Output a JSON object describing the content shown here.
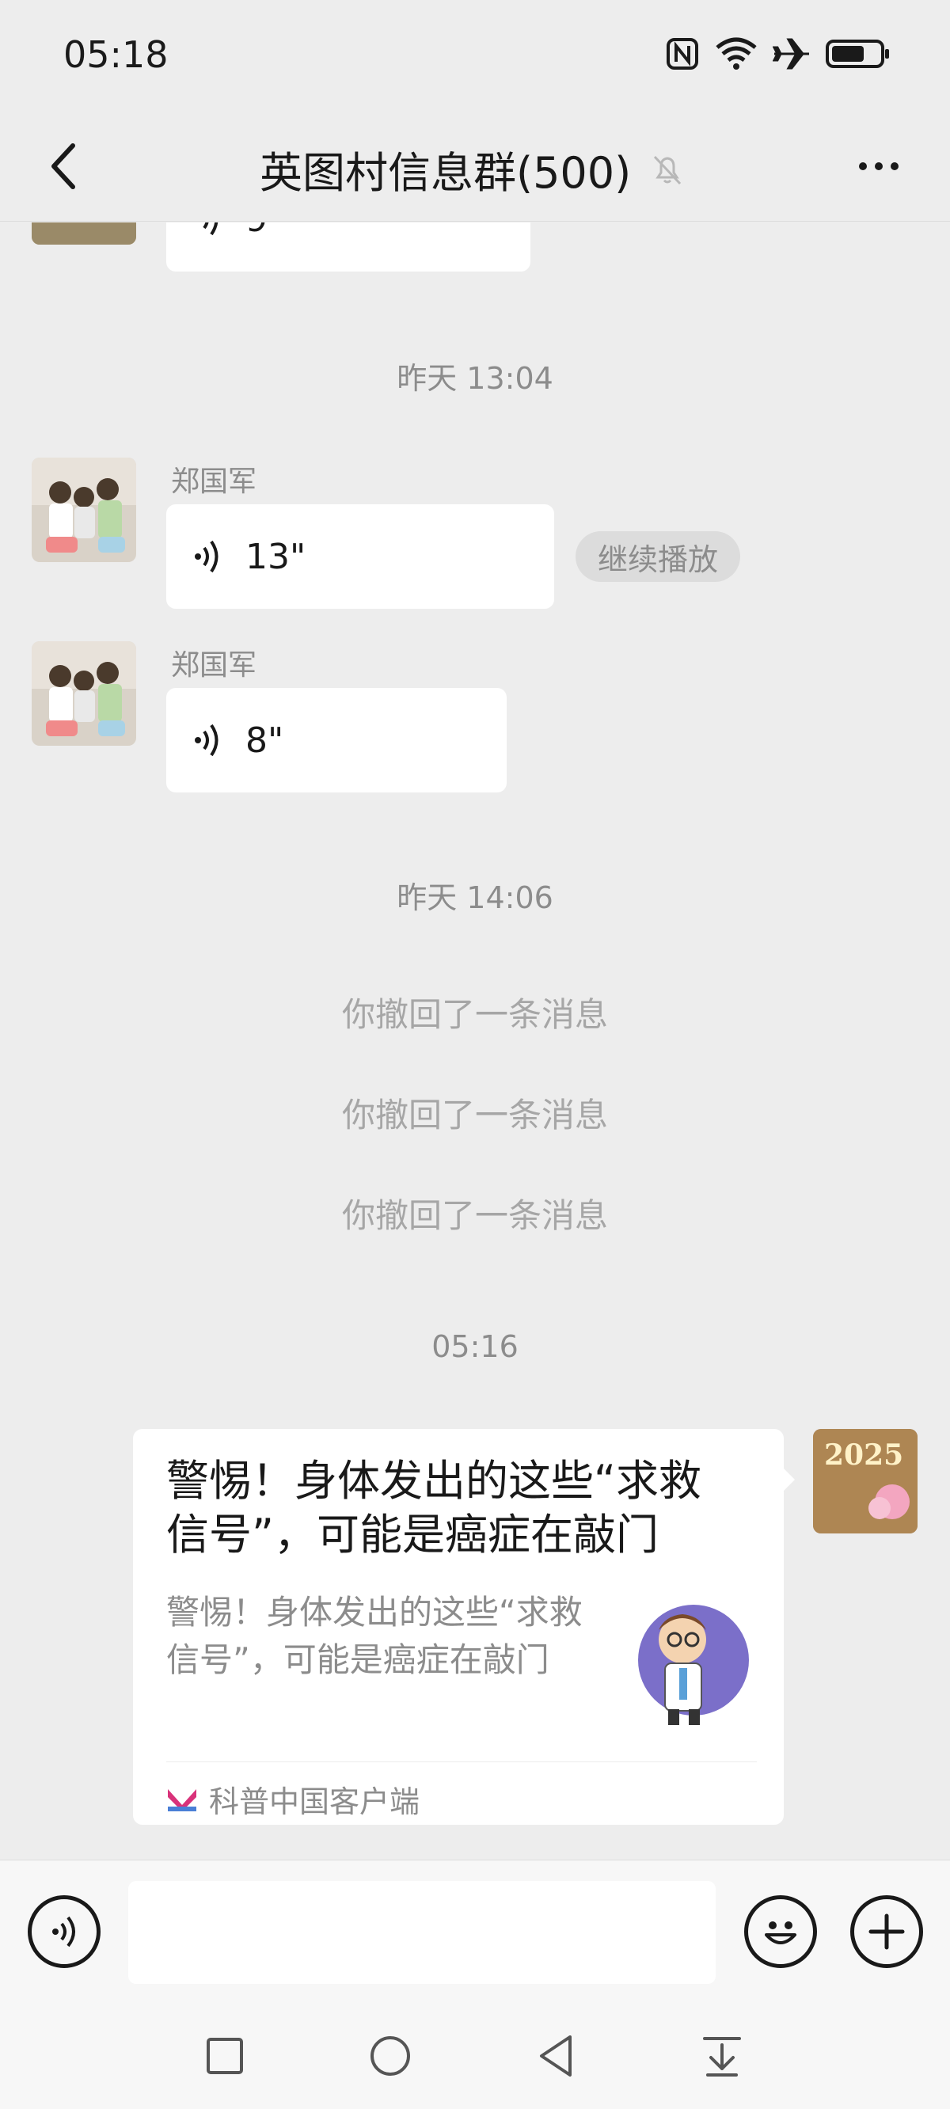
{
  "status_bar": {
    "time": "05:18",
    "icons": [
      "nfc-icon",
      "wifi-icon",
      "airplane-icon",
      "battery-icon"
    ]
  },
  "header": {
    "title": "英图村信息群(500)",
    "back_icon": "chevron-left-icon",
    "mute_icon": "bell-off-icon",
    "more_icon": "more-horizontal-icon"
  },
  "messages": {
    "top_partial": {
      "duration": "9\""
    },
    "time_1": "昨天 13:04",
    "voice_1": {
      "sender": "郑国军",
      "duration": "13\"",
      "continue_label": "继续播放"
    },
    "voice_2": {
      "sender": "郑国军",
      "duration": "8\""
    },
    "time_2": "昨天 14:06",
    "recalled": [
      "你撤回了一条消息",
      "你撤回了一条消息",
      "你撤回了一条消息"
    ],
    "time_3": "05:16",
    "link_card": {
      "title": "警惕！身体发出的这些“求救信号”，可能是癌症在敲门",
      "description": "警惕！身体发出的这些“求救信号”，可能是癌症在敲门",
      "source": "科普中国客户端",
      "avatar_text": "2025"
    }
  },
  "input_bar": {
    "voice_icon": "voice-icon",
    "emoji_icon": "emoji-icon",
    "plus_icon": "plus-icon",
    "input_value": ""
  },
  "nav_bar": {
    "icons": [
      "recent-apps-icon",
      "home-icon",
      "back-icon",
      "notification-shade-icon"
    ]
  },
  "colors": {
    "background": "#ededed",
    "bubble": "#ffffff",
    "muted_text": "#8c8c8c"
  }
}
